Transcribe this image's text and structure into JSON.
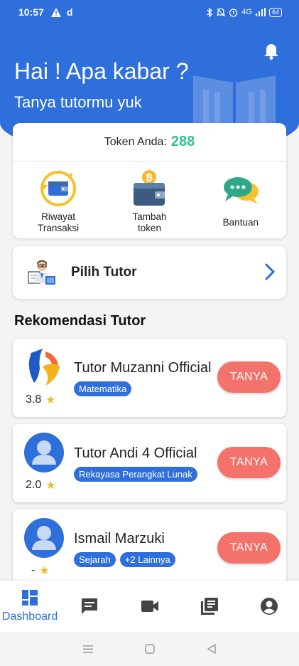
{
  "status_bar": {
    "time": "10:57",
    "left_icons": [
      "warning-icon",
      "d-icon"
    ],
    "right_icons": [
      "bluetooth-icon",
      "mute-icon",
      "alarm-icon",
      "signal-icon"
    ],
    "network": "4G",
    "battery": "64"
  },
  "header": {
    "greeting": "Hai ! Apa kabar ?",
    "subtitle": "Tanya tutormu yuk",
    "bg_color": "#2e6fdc"
  },
  "token": {
    "label": "Token Anda:",
    "value": "288",
    "value_color": "#35c38a"
  },
  "actions": [
    {
      "label": "Riwayat\nTransaksi",
      "icon": "history-wallet-icon"
    },
    {
      "label": "Tambah\ntoken",
      "icon": "wallet-coin-icon"
    },
    {
      "label": "Bantuan",
      "icon": "chat-bubbles-icon"
    }
  ],
  "pilih_tutor": {
    "label": "Pilih Tutor"
  },
  "recommend": {
    "title": "Rekomendasi Tutor",
    "tutors": [
      {
        "name": "Tutor Muzanni Official",
        "rating": "3.8",
        "tags": [
          "Matematika"
        ],
        "button": "TANYA"
      },
      {
        "name": "Tutor Andi 4 Official",
        "rating": "2.0",
        "tags": [
          "Rekayasa Perangkat Lunak"
        ],
        "button": "TANYA"
      },
      {
        "name": "Ismail Marzuki",
        "rating": "-",
        "tags": [
          "Sejarah",
          "+2 Lainnya"
        ],
        "button": "TANYA"
      }
    ]
  },
  "bottom_nav": {
    "active_label": "Dashboard",
    "items": [
      "dashboard-icon",
      "chat-icon",
      "video-icon",
      "library-icon",
      "account-icon"
    ]
  },
  "colors": {
    "accent": "#2e6fdc",
    "button": "#f3726b",
    "star": "#f3b72e"
  }
}
